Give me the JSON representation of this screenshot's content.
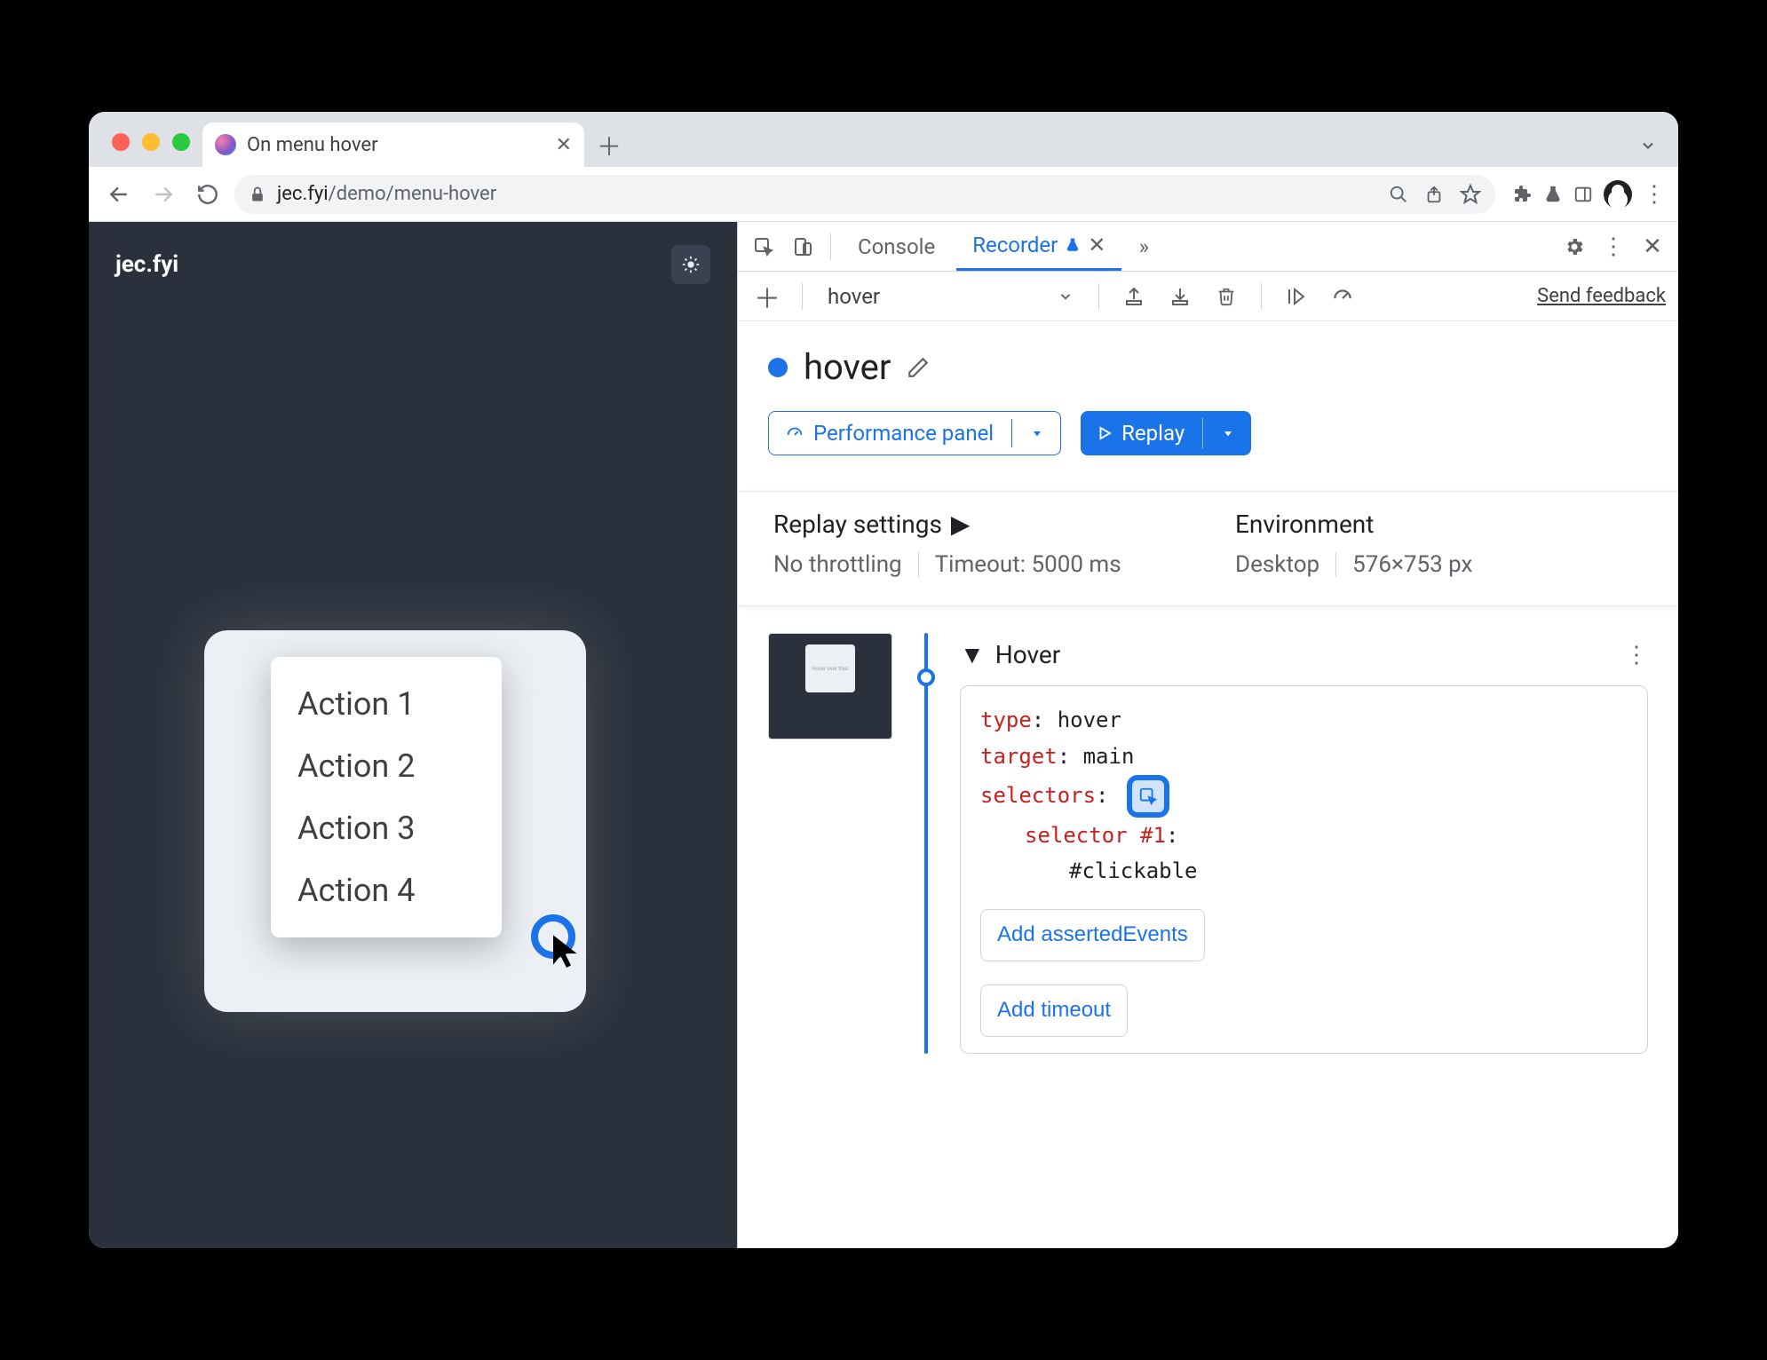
{
  "browser": {
    "tab_title": "On menu hover",
    "url_host": "jec.fyi",
    "url_path": "/demo/menu-hover"
  },
  "page": {
    "brand": "jec.fyi",
    "card_placeholder": "H                e!",
    "menu_items": [
      "Action 1",
      "Action 2",
      "Action 3",
      "Action 4"
    ]
  },
  "devtools": {
    "tabs": {
      "console": "Console",
      "recorder": "Recorder"
    },
    "recorder": {
      "dropdown_value": "hover",
      "feedback_label": "Send feedback",
      "title": "hover",
      "perf_button": "Performance panel",
      "replay_button": "Replay",
      "replay_head": "Replay settings",
      "env_head": "Environment",
      "throttling": "No throttling",
      "timeout": "Timeout: 5000 ms",
      "device": "Desktop",
      "viewport": "576×753 px",
      "step_name": "Hover",
      "code": {
        "type_key": "type",
        "type_val": "hover",
        "target_key": "target",
        "target_val": "main",
        "selectors_key": "selectors",
        "selector_label": "selector #1",
        "selector_val": "#clickable"
      },
      "add_asserted": "Add assertedEvents",
      "add_timeout": "Add timeout"
    }
  }
}
